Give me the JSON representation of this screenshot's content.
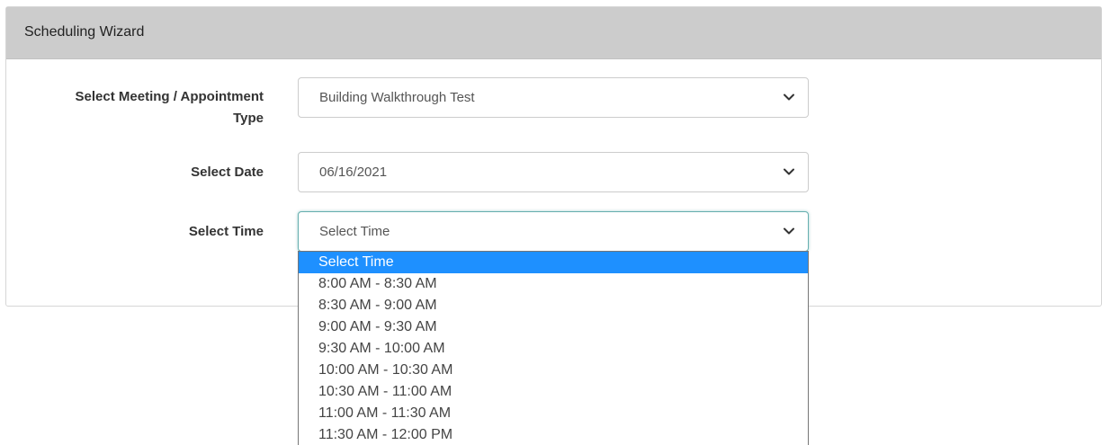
{
  "panel": {
    "title": "Scheduling Wizard"
  },
  "form": {
    "meeting_type": {
      "label_line1": "Select Meeting / Appointment",
      "label_line2": "Type",
      "value": "Building Walkthrough Test",
      "icon": "chevron-down-icon"
    },
    "date": {
      "label": "Select Date",
      "value": "06/16/2021",
      "icon": "chevron-down-icon"
    },
    "time": {
      "label": "Select Time",
      "value": "Select Time",
      "icon": "chevron-down-icon",
      "options": [
        "Select Time",
        "8:00 AM - 8:30 AM",
        "8:30 AM - 9:00 AM",
        "9:00 AM - 9:30 AM",
        "9:30 AM - 10:00 AM",
        "10:00 AM - 10:30 AM",
        "10:30 AM - 11:00 AM",
        "11:00 AM - 11:30 AM",
        "11:30 AM - 12:00 PM"
      ],
      "selected_index": 0
    }
  },
  "colors": {
    "header_bg": "#cccccc",
    "highlight": "#1e90ff",
    "focus_border": "#66afaf"
  }
}
